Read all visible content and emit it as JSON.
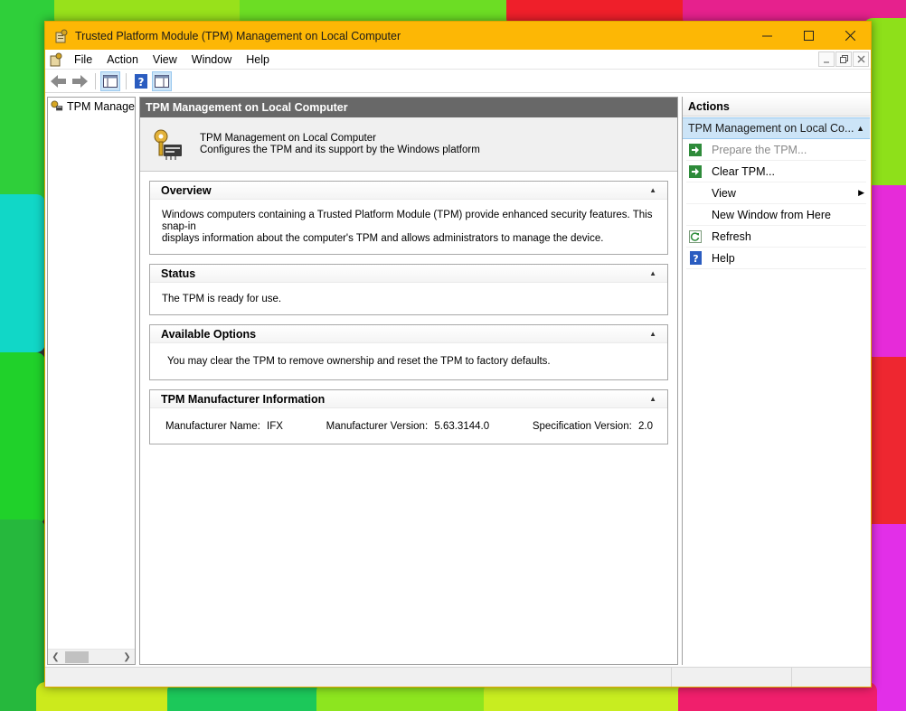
{
  "window": {
    "title": "Trusted Platform Module (TPM) Management on Local Computer"
  },
  "menu": {
    "items": [
      "File",
      "Action",
      "View",
      "Window",
      "Help"
    ]
  },
  "tree": {
    "item_label": "TPM Manage"
  },
  "center": {
    "header": "TPM Management on Local Computer",
    "intro_title": "TPM Management on Local Computer",
    "intro_desc": "Configures the TPM and its support by the Windows platform",
    "sections": {
      "overview": {
        "title": "Overview",
        "text_line1": "Windows computers containing a Trusted Platform Module (TPM) provide enhanced security features. This snap-in",
        "text_line2": "displays information about the computer's TPM and allows administrators to manage the device."
      },
      "status": {
        "title": "Status",
        "text": "The TPM is ready for use."
      },
      "options": {
        "title": "Available Options",
        "text": "You may clear the TPM to remove ownership and reset the TPM to factory defaults."
      },
      "manufacturer": {
        "title": "TPM Manufacturer Information",
        "name_label": "Manufacturer Name:",
        "name_value": "IFX",
        "version_label": "Manufacturer Version:",
        "version_value": "5.63.3144.0",
        "spec_label": "Specification Version:",
        "spec_value": "2.0"
      }
    }
  },
  "actions": {
    "title": "Actions",
    "group": "TPM Management on Local Co...",
    "items": [
      {
        "label": "Prepare the TPM...",
        "icon": "green-arrow-icon",
        "disabled": true
      },
      {
        "label": "Clear TPM...",
        "icon": "green-arrow-icon",
        "disabled": false
      },
      {
        "label": "View",
        "icon": "",
        "disabled": false
      },
      {
        "label": "New Window from Here",
        "icon": "",
        "disabled": false
      },
      {
        "label": "Refresh",
        "icon": "refresh-icon",
        "disabled": false
      },
      {
        "label": "Help",
        "icon": "help-icon",
        "disabled": false
      }
    ]
  },
  "colors": {
    "titlebar": "#fdb705",
    "center_header": "#686868",
    "selection": "#cce4f7"
  }
}
